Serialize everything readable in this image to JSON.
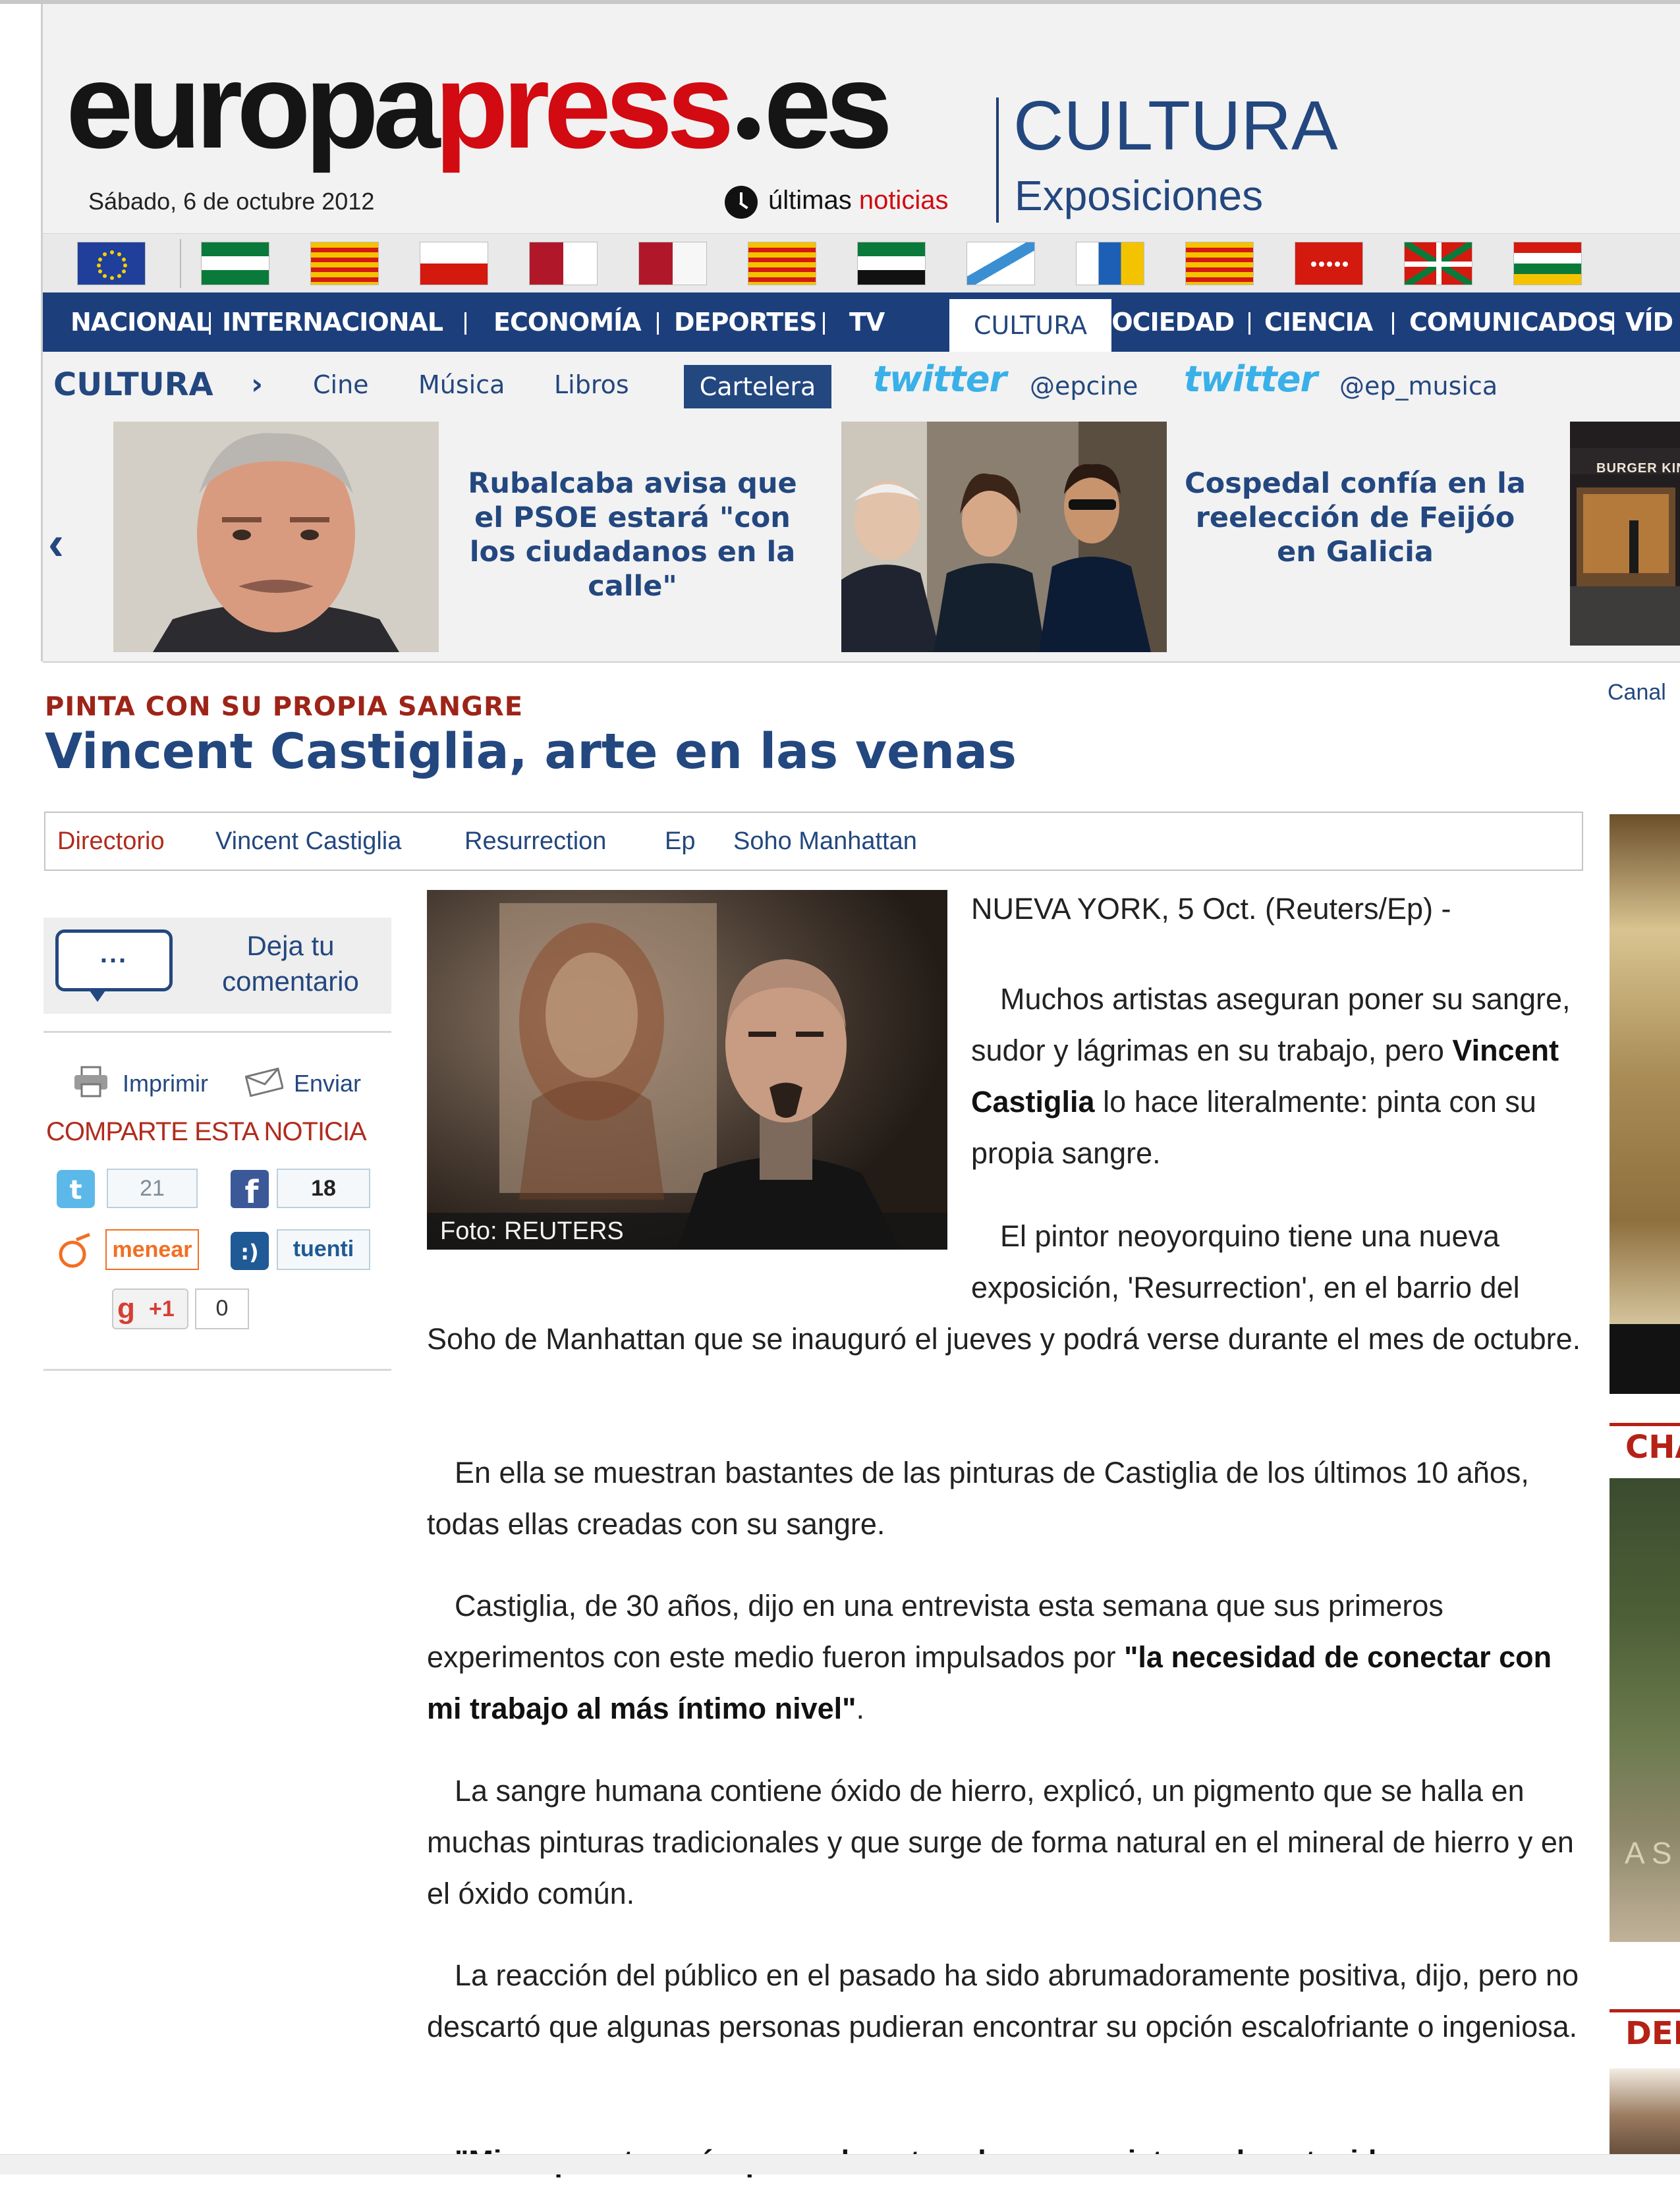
{
  "header": {
    "logo": {
      "part1": "europa",
      "part2": "press",
      "part3": "es"
    },
    "date": "Sábado, 6 de octubre 2012",
    "latest_news": {
      "word1": "últimas",
      "word2": "noticias"
    },
    "section": "CULTURA",
    "subsection": "Exposiciones"
  },
  "regions": [
    "european-union-flag",
    "andalucia-flag",
    "aragon-flag",
    "cantabria-flag",
    "castilla-la-mancha-flag",
    "castilla-leon-flag",
    "cataluna-flag",
    "extremadura-flag",
    "galicia-flag",
    "canarias-flag",
    "baleares-flag",
    "madrid-flag",
    "pais-vasco-flag",
    "la-rioja-flag"
  ],
  "nav": {
    "items": [
      "NACIONAL",
      "INTERNACIONAL",
      "ECONOMÍA",
      "DEPORTES",
      "TV",
      "CULTURA",
      "SOCIEDAD",
      "CIENCIA",
      "COMUNICADOS",
      "VÍD"
    ],
    "active": "CULTURA"
  },
  "subnav": {
    "section": "CULTURA",
    "chevron": "›",
    "items": [
      "Cine",
      "Música",
      "Libros"
    ],
    "active": "Cartelera",
    "twitter_word": "twitter",
    "handles": [
      "@epcine",
      "@ep_musica"
    ]
  },
  "carousel": {
    "prev": "‹",
    "items": [
      {
        "text": "Rubalcaba avisa que el PSOE estará \"con los ciudadanos en la calle\""
      },
      {
        "text": "Cospedal confía en la reelección de Feijóo en Galicia"
      }
    ],
    "third_image_sign": "BURGER KIN"
  },
  "article": {
    "kicker": "PINTA CON SU PROPIA SANGRE",
    "headline": "Vincent Castiglia, arte en las venas",
    "canal": "Canal",
    "tags": [
      "Directorio",
      "Vincent Castiglia",
      "Resurrection",
      "Ep",
      "Soho Manhattan"
    ],
    "photo_caption": "Foto: REUTERS",
    "dateline": "NUEVA YORK, 5 Oct. (Reuters/Ep) -",
    "p1": {
      "a": "Muchos artistas aseguran poner su sangre, sudor y lágrimas en su trabajo, pero ",
      "b": "Vincent Castiglia",
      "c": " lo hace literalmente: pinta con su propia sangre."
    },
    "p2": "El pintor neoyorquino tiene una nueva exposición, 'Resurrection', en el barrio del Soho de Manhattan que se inauguró el jueves y podrá verse durante el mes de octubre.",
    "p3": "En ella se muestran bastantes de las pinturas de Castiglia de los últimos 10 años, todas ellas creadas con su sangre.",
    "p4": {
      "a": "Castiglia, de 30 años, dijo en una entrevista esta semana que sus primeros experimentos con este medio fueron impulsados por ",
      "b": "\"la necesidad de conectar con mi trabajo al más íntimo nivel\"",
      "c": "."
    },
    "p5": "La sangre humana contiene óxido de hierro, explicó, un pigmento que se halla en muchas pinturas tradicionales y que surge de forma natural en el mineral de hierro y en el óxido común.",
    "p6": "La reacción del público en el pasado ha sido abrumadoramente positiva, dijo, pero no descartó que algunas personas pudieran encontrar su opción escalofriante o ingeniosa.",
    "p7": "\"Mi respuesta sería que realmente echaran un vistazo al contenido"
  },
  "tools": {
    "comment_dots": "...",
    "comment_label": "Deja tu comentario",
    "print": "Imprimir",
    "send": "Enviar",
    "share_title": "COMPARTE ESTA NOTICIA",
    "twitter_count": "21",
    "facebook_count": "18",
    "meneame_label": "menear",
    "tuenti_label": "tuenti",
    "gplus_label": "+1",
    "gplus_count": "0"
  },
  "right": {
    "head1": "CHA",
    "head2": "DEF",
    "image_text": "A S"
  },
  "colors": {
    "brand_red": "#d20a11",
    "nav_blue": "#1c3f7c",
    "link_blue": "#23477f",
    "kicker_red": "#9e2418"
  }
}
